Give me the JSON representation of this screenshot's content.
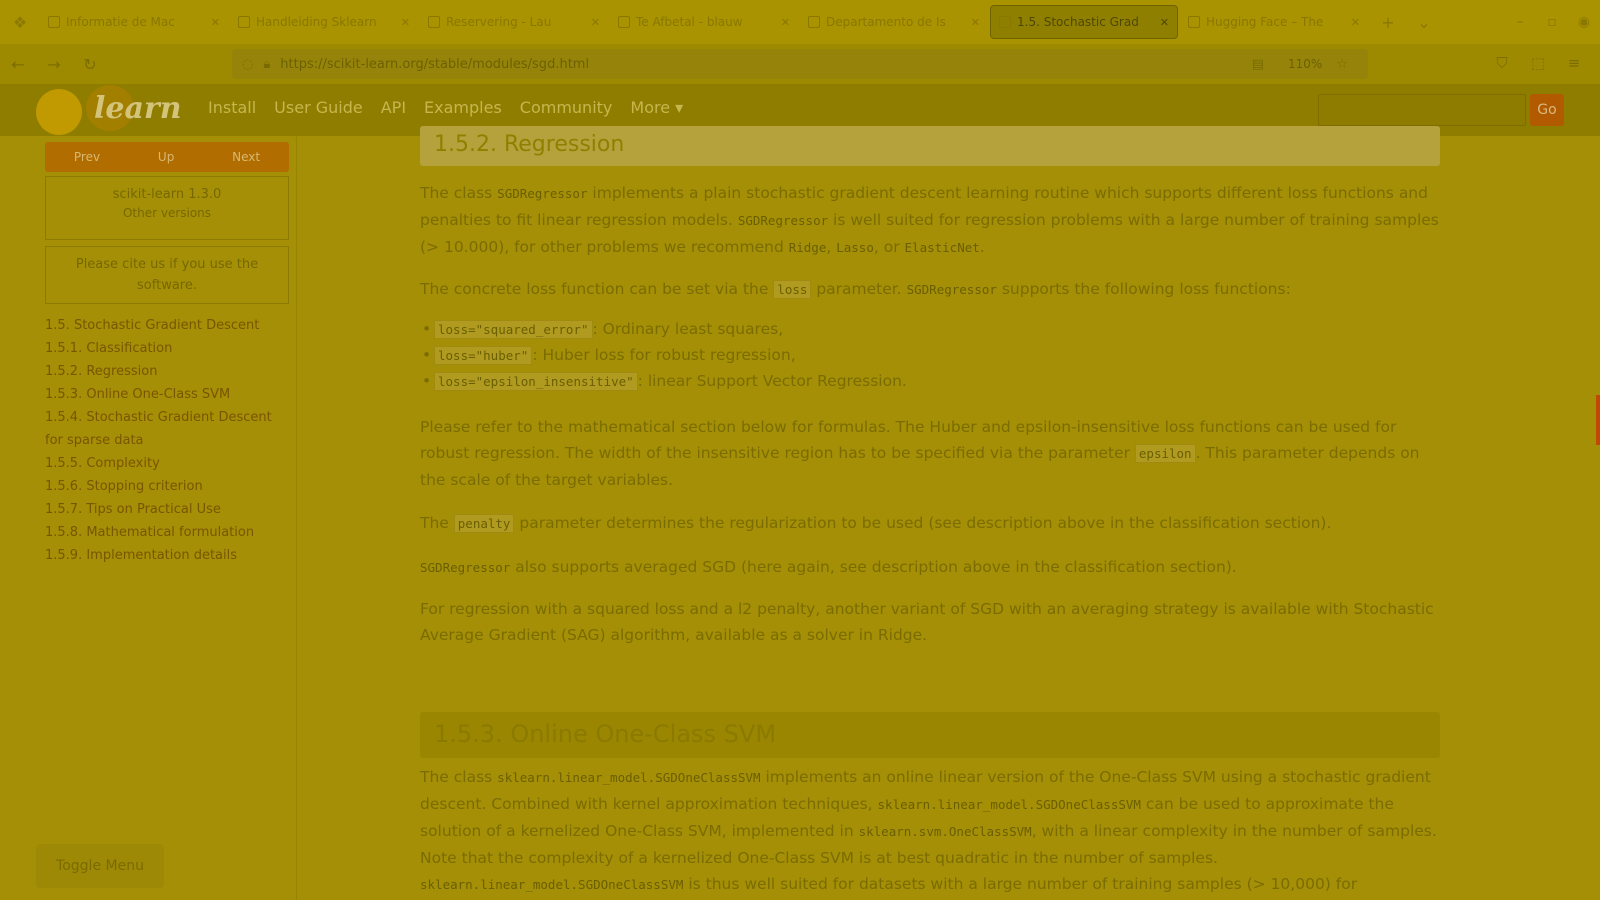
{
  "browser": {
    "tabs": [
      {
        "title": "Informatie de Mac",
        "active": false
      },
      {
        "title": "Handleiding Sklearn",
        "active": false
      },
      {
        "title": "Reservering - Lau",
        "active": false
      },
      {
        "title": "Te Afbetal - blauw",
        "active": false
      },
      {
        "title": "Departamento de Is",
        "active": false
      },
      {
        "title": "1.5. Stochastic Grad",
        "active": true
      },
      {
        "title": "Hugging Face – The",
        "active": false
      }
    ],
    "url": "https://scikit-learn.org/stable/modules/sgd.html",
    "zoom": "110%"
  },
  "site": {
    "logo_text": "learn",
    "nav": [
      "Install",
      "User Guide",
      "API",
      "Examples",
      "Community",
      "More ▾"
    ],
    "go_label": "Go"
  },
  "sidebar": {
    "buttons": [
      "Prev",
      "Up",
      "Next"
    ],
    "version": "scikit-learn 1.3.0",
    "other_versions": "Other versions",
    "cite": "Please cite us if you use the software.",
    "toc": [
      "1.5. Stochastic Gradient Descent",
      "1.5.1. Classification",
      "1.5.2. Regression",
      "1.5.3. Online One-Class SVM",
      "1.5.4. Stochastic Gradient Descent for sparse data",
      "1.5.5. Complexity",
      "1.5.6. Stopping criterion",
      "1.5.7. Tips on Practical Use",
      "1.5.8. Mathematical formulation",
      "1.5.9. Implementation details"
    ],
    "toggle": "Toggle Menu"
  },
  "main": {
    "h_regression": "1.5.2. Regression",
    "p1_a": "The class ",
    "p1_code1": "SGDRegressor",
    "p1_b": " implements a plain stochastic gradient descent learning routine which supports different loss functions and penalties to fit linear regression models. ",
    "p1_code2": "SGDRegressor",
    "p1_c": " is well suited for regression problems with a large number of training samples (> 10.000), for other problems we recommend ",
    "p1_code3": "Ridge",
    "p1_d": ", ",
    "p1_code4": "Lasso",
    "p1_e": ", or ",
    "p1_code5": "ElasticNet",
    "p1_f": ".",
    "p2_a": "The concrete loss function can be set via the ",
    "p2_code1": "loss",
    "p2_b": " parameter. ",
    "p2_code2": "SGDRegressor",
    "p2_c": " supports the following loss functions:",
    "list": [
      {
        "code": "loss=\"squared_error\"",
        "text": ": Ordinary least squares,"
      },
      {
        "code": "loss=\"huber\"",
        "text": ": Huber loss for robust regression,"
      },
      {
        "code": "loss=\"epsilon_insensitive\"",
        "text": ": linear Support Vector Regression."
      }
    ],
    "p3_a": "Please refer to the mathematical section below for formulas. The Huber and epsilon-insensitive loss functions can be used for robust regression. The width of the insensitive region has to be specified via the parameter ",
    "p3_code": "epsilon",
    "p3_b": ". This parameter depends on the scale of the target variables.",
    "p4_a": "The ",
    "p4_code": "penalty",
    "p4_b": " parameter determines the regularization to be used (see description above in the classification section).",
    "p5_code": "SGDRegressor",
    "p5_b": " also supports averaged SGD (here again, see description above in the classification section).",
    "p6": "For regression with a squared loss and a l2 penalty, another variant of SGD with an averaging strategy is available with Stochastic Average Gradient (SAG) algorithm, available as a solver in Ridge.",
    "h_ocsvm": "1.5.3. Online One-Class SVM",
    "p7_a": "The class ",
    "p7_code1": "sklearn.linear_model.SGDOneClassSVM",
    "p7_b": " implements an online linear version of the One-Class SVM using a stochastic gradient descent. Combined with kernel approximation techniques, ",
    "p7_code2": "sklearn.linear_model.SGDOneClassSVM",
    "p7_c": " can be used to approximate the solution of a kernelized One-Class SVM, implemented in ",
    "p7_code3": "sklearn.svm.OneClassSVM",
    "p7_d": ", with a linear complexity in the number of samples. Note that the complexity of a kernelized One-Class SVM is at best quadratic in the number of samples. ",
    "p7_code4": "sklearn.linear_model.SGDOneClassSVM",
    "p7_e": " is thus well suited for datasets with a large number of training samples (> 10,000) for"
  }
}
